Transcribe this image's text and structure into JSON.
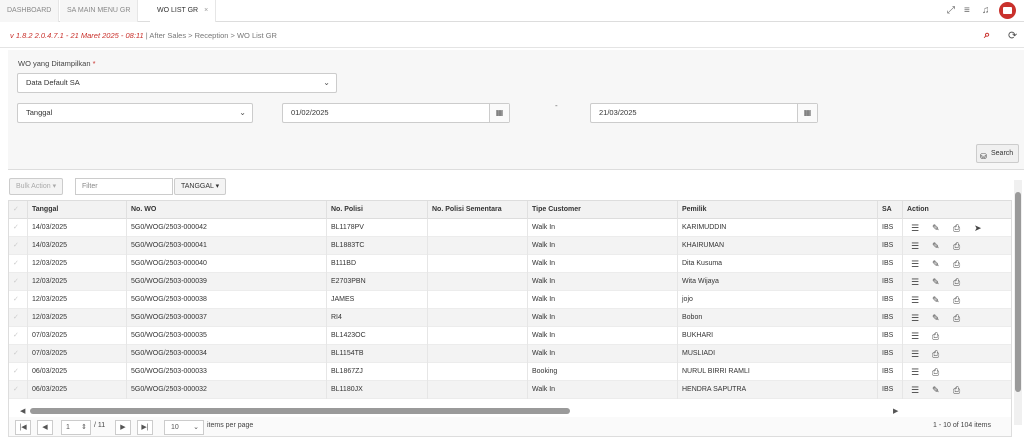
{
  "tabs": [
    {
      "label": "DASHBOARD"
    },
    {
      "label": "SA MAIN MENU GR"
    },
    {
      "label": "WO LIST GR",
      "close": "×"
    }
  ],
  "breadcrumb": {
    "version": "v 1.8.2 2.0.4.7.1 - 21 Maret 2025 - 08:11",
    "path": " | After Sales  >  Reception  >  WO List GR"
  },
  "filters": {
    "wo_label": "WO yang Ditampilkan",
    "required_mark": "*",
    "wo_value": "Data Default SA",
    "date_type": "Tanggal",
    "date_from": "01/02/2025",
    "date_sep": "-",
    "date_to": "21/03/2025",
    "search_label": "Search"
  },
  "toolbar": {
    "bulk_action": "Bulk Action ▾",
    "filter_placeholder": "Filter",
    "tanggal_button": "TANGGAL ▾"
  },
  "table": {
    "headers": [
      "Tanggal",
      "No. WO",
      "No. Polisi",
      "No. Polisi Sementara",
      "Tipe Customer",
      "Pemilik",
      "SA",
      "Action"
    ],
    "rows": [
      {
        "tanggal": "14/03/2025",
        "no_wo": "5G0/WOG/2503-000042",
        "no_polisi": "BL1178PV",
        "no_polisi_sementara": "",
        "tipe": "Walk In",
        "pemilik": "KARIMUDDIN",
        "sa": "IBS",
        "actions": [
          "list",
          "edit",
          "print",
          "send"
        ]
      },
      {
        "tanggal": "14/03/2025",
        "no_wo": "5G0/WOG/2503-000041",
        "no_polisi": "BL1883TC",
        "no_polisi_sementara": "",
        "tipe": "Walk In",
        "pemilik": "KHAIRUMAN",
        "sa": "IBS",
        "actions": [
          "list",
          "edit",
          "print"
        ]
      },
      {
        "tanggal": "12/03/2025",
        "no_wo": "5G0/WOG/2503-000040",
        "no_polisi": "B111BD",
        "no_polisi_sementara": "",
        "tipe": "Walk In",
        "pemilik": "Dita Kusuma",
        "sa": "IBS",
        "actions": [
          "list",
          "edit",
          "print"
        ]
      },
      {
        "tanggal": "12/03/2025",
        "no_wo": "5G0/WOG/2503-000039",
        "no_polisi": "E2703PBN",
        "no_polisi_sementara": "",
        "tipe": "Walk In",
        "pemilik": "Wita Wijaya",
        "sa": "IBS",
        "actions": [
          "list",
          "edit",
          "print"
        ]
      },
      {
        "tanggal": "12/03/2025",
        "no_wo": "5G0/WOG/2503-000038",
        "no_polisi": "JAMES",
        "no_polisi_sementara": "",
        "tipe": "Walk In",
        "pemilik": "jojo",
        "sa": "IBS",
        "actions": [
          "list",
          "edit",
          "print"
        ]
      },
      {
        "tanggal": "12/03/2025",
        "no_wo": "5G0/WOG/2503-000037",
        "no_polisi": "RI4",
        "no_polisi_sementara": "",
        "tipe": "Walk In",
        "pemilik": "Bobon",
        "sa": "IBS",
        "actions": [
          "list",
          "edit",
          "print"
        ]
      },
      {
        "tanggal": "07/03/2025",
        "no_wo": "5G0/WOG/2503-000035",
        "no_polisi": "BL1423OC",
        "no_polisi_sementara": "",
        "tipe": "Walk In",
        "pemilik": "BUKHARI",
        "sa": "IBS",
        "actions": [
          "list",
          "print"
        ]
      },
      {
        "tanggal": "07/03/2025",
        "no_wo": "5G0/WOG/2503-000034",
        "no_polisi": "BL1154TB",
        "no_polisi_sementara": "",
        "tipe": "Walk In",
        "pemilik": "MUSLIADI",
        "sa": "IBS",
        "actions": [
          "list",
          "print"
        ]
      },
      {
        "tanggal": "06/03/2025",
        "no_wo": "5G0/WOG/2503-000033",
        "no_polisi": "BL1867ZJ",
        "no_polisi_sementara": "",
        "tipe": "Booking",
        "pemilik": "NURUL BIRRI RAMLI",
        "sa": "IBS",
        "actions": [
          "list",
          "print"
        ]
      },
      {
        "tanggal": "06/03/2025",
        "no_wo": "5G0/WOG/2503-000032",
        "no_polisi": "BL1180JX",
        "no_polisi_sementara": "",
        "tipe": "Walk In",
        "pemilik": "HENDRA SAPUTRA",
        "sa": "IBS",
        "actions": [
          "list",
          "edit",
          "print"
        ]
      }
    ]
  },
  "pager": {
    "current_page": "1",
    "total_pages": "/ 11",
    "page_size": "10",
    "items_per_page_label": "items per page",
    "summary": "1 - 10 of 104 items"
  },
  "icons": {
    "first": "|◀",
    "prev": "◀",
    "next": "▶",
    "last": "▶|",
    "calendar": "▦",
    "chevron": "⌄",
    "list": "☰",
    "edit": "✎",
    "print": "⎙",
    "send": "➤"
  },
  "colors": {
    "accent": "#c9312c"
  }
}
